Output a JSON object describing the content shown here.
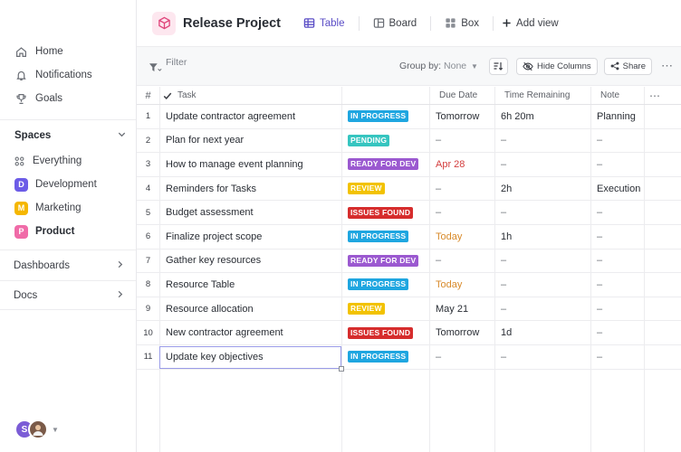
{
  "sidebar": {
    "nav": [
      {
        "label": "Home",
        "icon": "home-icon"
      },
      {
        "label": "Notifications",
        "icon": "bell-icon"
      },
      {
        "label": "Goals",
        "icon": "trophy-icon"
      }
    ],
    "spaces_label": "Spaces",
    "everything_label": "Everything",
    "spaces": [
      {
        "letter": "D",
        "label": "Development",
        "color": "#6c5ce7"
      },
      {
        "letter": "M",
        "label": "Marketing",
        "color": "#f5b700"
      },
      {
        "letter": "P",
        "label": "Product",
        "color": "#f06ba8"
      }
    ],
    "dashboards_label": "Dashboards",
    "docs_label": "Docs",
    "avatar_initial": "S"
  },
  "header": {
    "project_title": "Release Project",
    "views": [
      {
        "label": "Table",
        "icon": "table-icon",
        "active": true
      },
      {
        "label": "Board",
        "icon": "board-icon",
        "active": false
      },
      {
        "label": "Box",
        "icon": "box-icon",
        "active": false
      }
    ],
    "add_view_label": "Add view"
  },
  "toolbar": {
    "filter_label": "Filter",
    "group_by_label": "Group by:",
    "group_by_value": "None",
    "hide_columns_label": "Hide Columns",
    "share_label": "Share"
  },
  "table": {
    "headers": {
      "num": "#",
      "task": "Task",
      "due": "Due Date",
      "time": "Time Remaining",
      "note": "Note"
    },
    "status_colors": {
      "IN PROGRESS": "#1fa6e0",
      "PENDING": "#36c5c0",
      "READY FOR DEV": "#9b59d0",
      "REVIEW": "#f2c200",
      "ISSUES FOUND": "#d62d2d"
    },
    "rows": [
      {
        "num": "1",
        "task": "Update contractor agreement",
        "status": "IN PROGRESS",
        "due": "Tomorrow",
        "due_color": "",
        "time": "6h 20m",
        "note": "Planning"
      },
      {
        "num": "2",
        "task": "Plan for next year",
        "status": "PENDING",
        "due": "–",
        "due_color": "",
        "time": "–",
        "note": "–"
      },
      {
        "num": "3",
        "task": "How to manage event planning",
        "status": "READY FOR DEV",
        "due": "Apr 28",
        "due_color": "red",
        "time": "–",
        "note": "–"
      },
      {
        "num": "4",
        "task": "Reminders for Tasks",
        "status": "REVIEW",
        "due": "–",
        "due_color": "",
        "time": "2h",
        "note": "Execution"
      },
      {
        "num": "5",
        "task": "Budget assessment",
        "status": "ISSUES FOUND",
        "due": "–",
        "due_color": "",
        "time": "–",
        "note": "–"
      },
      {
        "num": "6",
        "task": "Finalize project scope",
        "status": "IN PROGRESS",
        "due": "Today",
        "due_color": "orange",
        "time": "1h",
        "note": "–"
      },
      {
        "num": "7",
        "task": "Gather key resources",
        "status": "READY FOR DEV",
        "due": "–",
        "due_color": "",
        "time": "–",
        "note": "–"
      },
      {
        "num": "8",
        "task": "Resource Table",
        "status": "IN PROGRESS",
        "due": "Today",
        "due_color": "orange",
        "time": "–",
        "note": "–"
      },
      {
        "num": "9",
        "task": "Resource allocation",
        "status": "REVIEW",
        "due": "May 21",
        "due_color": "",
        "time": "–",
        "note": "–"
      },
      {
        "num": "10",
        "task": "New contractor agreement",
        "status": "ISSUES FOUND",
        "due": "Tomorrow",
        "due_color": "",
        "time": "1d",
        "note": "–"
      },
      {
        "num": "11",
        "task": "Update key objectives",
        "status": "IN PROGRESS",
        "due": "–",
        "due_color": "",
        "time": "–",
        "note": "–"
      }
    ]
  }
}
